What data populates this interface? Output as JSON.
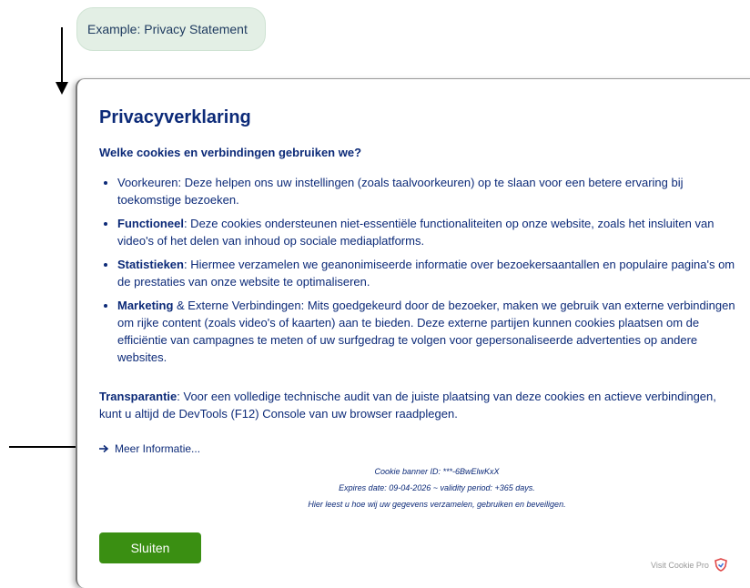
{
  "example_tag": {
    "text": "Example: Privacy Statement"
  },
  "dialog": {
    "title": "Privacyverklaring",
    "subtitle": "Welke cookies en verbindingen gebruiken we?",
    "items": [
      {
        "term": "",
        "text": "Voorkeuren: Deze helpen ons uw instellingen (zoals taalvoorkeuren) op te slaan voor een betere ervaring bij toekomstige bezoeken."
      },
      {
        "term": "Functioneel",
        "text": ": Deze cookies ondersteunen niet-essentiële functionaliteiten op onze website, zoals het insluiten van video's of het delen van inhoud op sociale mediaplatforms."
      },
      {
        "term": "Statistieken",
        "text": ": Hiermee verzamelen we geanonimiseerde informatie over bezoekersaantallen en populaire pagina's om de prestaties van onze website te optimaliseren."
      },
      {
        "term": "Marketing",
        "text": " & Externe Verbindingen: Mits goedgekeurd door de bezoeker, maken we gebruik van externe verbindingen om rijke content (zoals video's of kaarten) aan te bieden. Deze externe partijen kunnen cookies plaatsen om de efficiëntie van campagnes te meten of uw surfgedrag te volgen voor gepersonaliseerde advertenties op andere websites."
      }
    ],
    "transparency": {
      "term": "Transparantie",
      "text": ": Voor een volledige technische audit van de juiste plaatsing van deze cookies en actieve verbindingen, kunt u altijd de DevTools (F12) Console van uw browser raadplegen."
    },
    "more_info": "Meer Informatie...",
    "meta": {
      "banner_id": "Cookie banner ID: ***-6BwElwKxX",
      "expires": "Expires date: 09-04-2026 ~ validity period: +365 days.",
      "note": "Hier leest u hoe wij uw gegevens verzamelen, gebruiken en beveiligen."
    },
    "close_button": "Sluiten",
    "visit_link": "Visit Cookie Pro"
  },
  "colors": {
    "text": "#0c2a78",
    "button": "#3a8f12",
    "tag_bg": "#e3efe5"
  }
}
